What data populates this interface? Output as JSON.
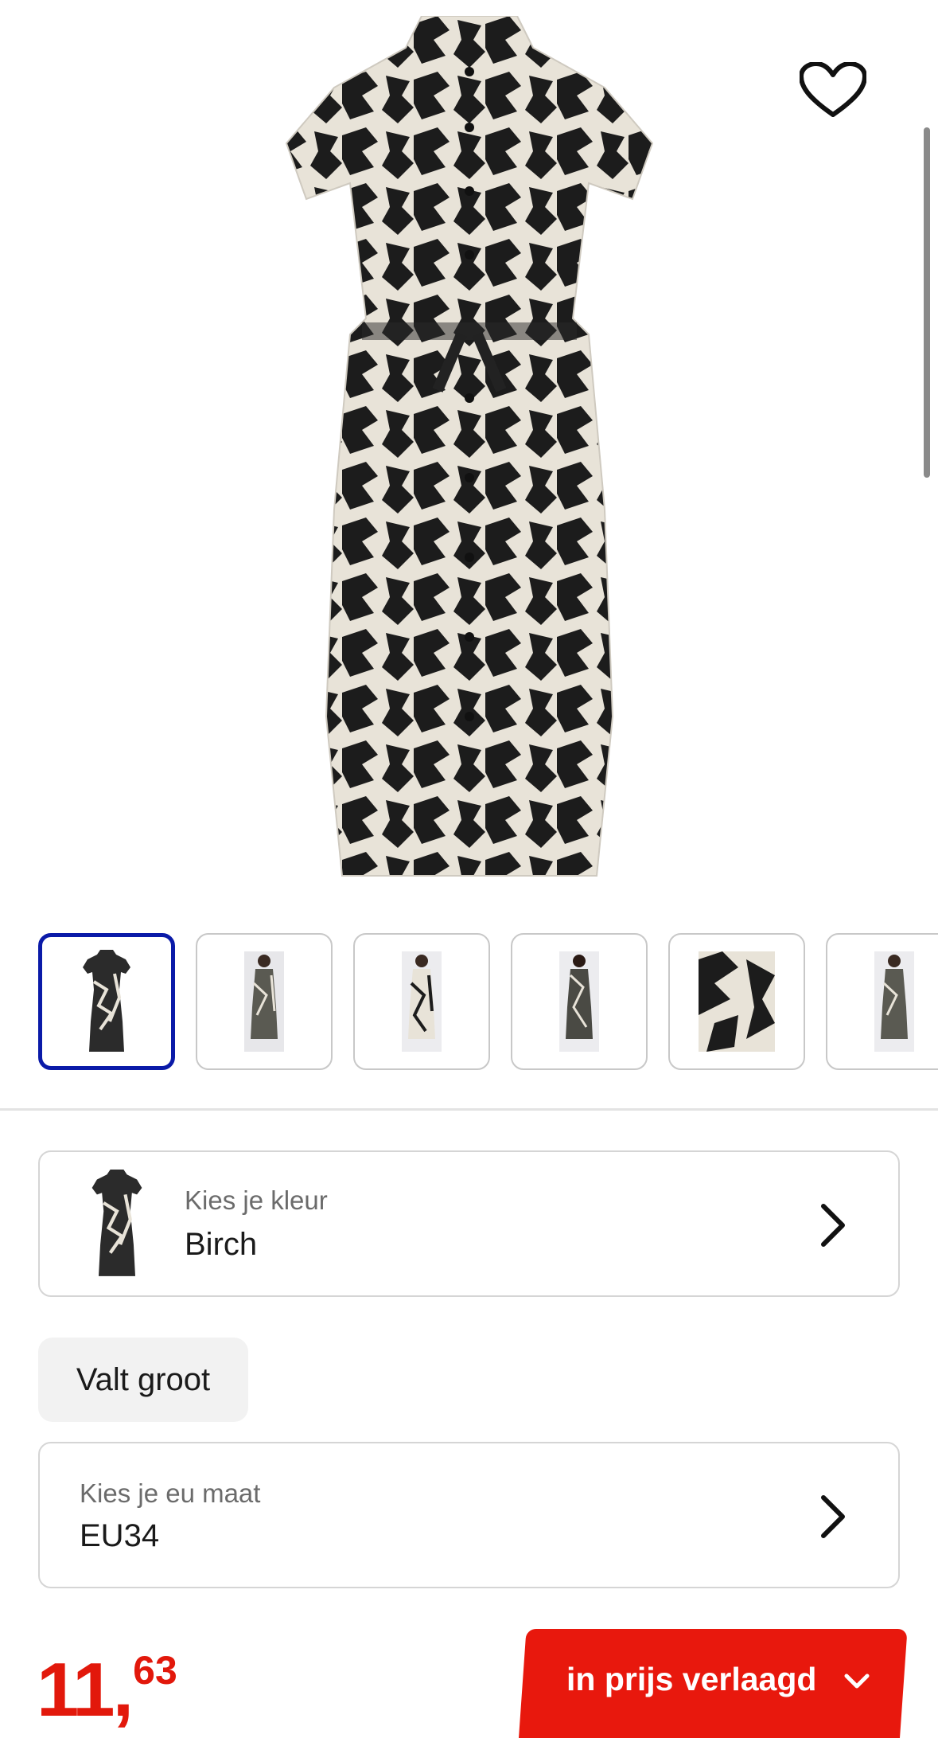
{
  "product": {
    "favorite_icon": "heart-outline-icon"
  },
  "thumbnails": [
    {
      "name": "thumb-product-front",
      "active": true
    },
    {
      "name": "thumb-model-front",
      "active": false
    },
    {
      "name": "thumb-model-front-2",
      "active": false
    },
    {
      "name": "thumb-model-back",
      "active": false
    },
    {
      "name": "thumb-detail",
      "active": false
    },
    {
      "name": "thumb-model-side",
      "active": false
    }
  ],
  "color_selector": {
    "caption": "Kies je kleur",
    "value": "Birch",
    "icon": "chevron-right-icon"
  },
  "fit_tag": "Valt groot",
  "size_selector": {
    "caption": "Kies je eu maat",
    "value": "EU34",
    "icon": "chevron-right-icon"
  },
  "price": {
    "integer": "11,",
    "decimal": "63"
  },
  "cta": {
    "label": "in prijs verlaagd",
    "icon": "chevron-down-icon"
  },
  "colors": {
    "accent_red": "#e8180d",
    "active_border": "#0a1aa8"
  }
}
